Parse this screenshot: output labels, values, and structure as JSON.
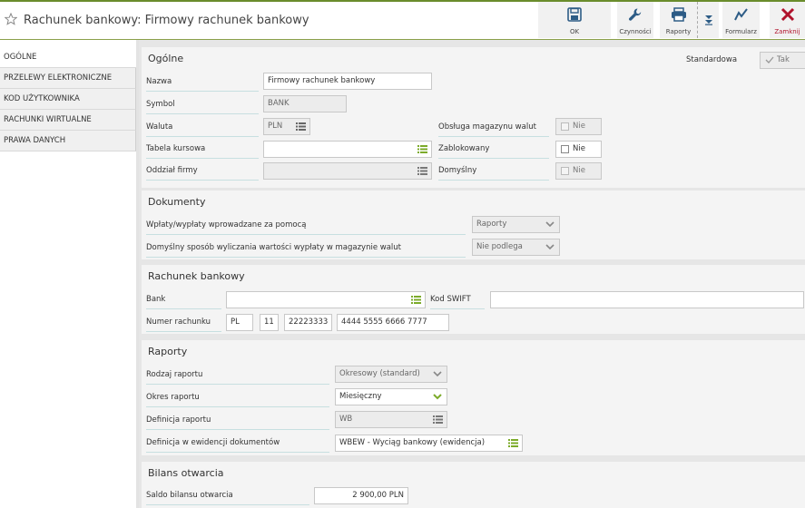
{
  "window": {
    "title": "Rachunek bankowy: Firmowy rachunek bankowy"
  },
  "toolbar": {
    "ok": "OK",
    "actions": "Czynności",
    "reports": "Raporty",
    "forms": "Formularz",
    "close": "Zamknij"
  },
  "sidebar": {
    "items": [
      {
        "label": "OGÓLNE"
      },
      {
        "label": "PRZELEWY ELEKTRONICZNE"
      },
      {
        "label": "KOD UŻYTKOWNIKA"
      },
      {
        "label": "RACHUNKI WIRTUALNE"
      },
      {
        "label": "PRAWA DANYCH"
      }
    ]
  },
  "general": {
    "title": "Ogólne",
    "standard_label": "Standardowa",
    "standard_value": "Tak",
    "name_label": "Nazwa",
    "name_value": "Firmowy rachunek bankowy",
    "symbol_label": "Symbol",
    "symbol_value": "BANK",
    "currency_label": "Waluta",
    "currency_value": "PLN",
    "rate_table_label": "Tabela kursowa",
    "rate_table_value": "",
    "branch_label": "Oddział firmy",
    "branch_value": "",
    "warehouse_label": "Obsługa magazynu walut",
    "warehouse_value": "Nie",
    "blocked_label": "Zablokowany",
    "blocked_value": "Nie",
    "default_label": "Domyślny",
    "default_value": "Nie"
  },
  "documents": {
    "title": "Dokumenty",
    "payments_label": "Wpłaty/wypłaty wprowadzane za pomocą",
    "payments_value": "Raporty",
    "calc_label": "Domyślny sposób wyliczania wartości wypłaty w magazynie walut",
    "calc_value": "Nie podlega"
  },
  "bank_account": {
    "title": "Rachunek bankowy",
    "bank_label": "Bank",
    "bank_value": "",
    "swift_label": "Kod SWIFT",
    "swift_value": "",
    "number_label": "Numer rachunku",
    "number_country": "PL",
    "number_check": "11",
    "number_bank": "22223333",
    "number_account": "4444 5555 6666 7777"
  },
  "reports": {
    "title": "Raporty",
    "type_label": "Rodzaj raportu",
    "type_value": "Okresowy (standard)",
    "period_label": "Okres raportu",
    "period_value": "Miesięczny",
    "definition_label": "Definicja raportu",
    "definition_value": "WB",
    "doc_definition_label": "Definicja w ewidencji dokumentów",
    "doc_definition_value": "WBEW - Wyciąg bankowy (ewidencja)"
  },
  "opening": {
    "title": "Bilans otwarcia",
    "balance_label": "Saldo bilansu otwarcia",
    "balance_value": "2 900,00 PLN"
  },
  "colors": {
    "accent": "#6a8c2c",
    "list_icon": "#7cab2a",
    "close": "#b0122b",
    "toolbar_icon": "#2d5c86"
  }
}
